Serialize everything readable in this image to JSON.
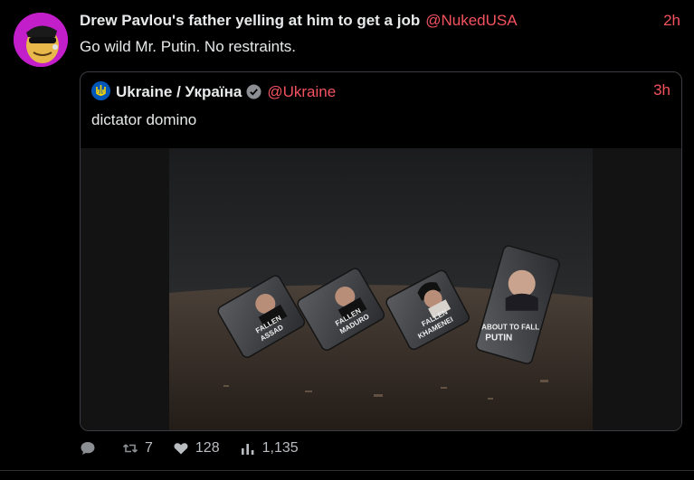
{
  "post": {
    "author": "Drew Pavlou's father yelling at him to get a job",
    "handle": "@NukedUSA",
    "time": "2h",
    "text": "Go wild Mr. Putin. No restraints.",
    "avatar_icon": "cartoon-face-avatar"
  },
  "quote": {
    "author": "Ukraine / Україна",
    "handle": "@Ukraine",
    "time": "3h",
    "text": "dictator domino",
    "verified_icon": "verified-badge-icon",
    "media": {
      "tiles": [
        {
          "line1": "FALLEN",
          "line2": "ASSAD"
        },
        {
          "line1": "FALLEN",
          "line2": "MADURO"
        },
        {
          "line1": "FALLEN",
          "line2": "KHAMENEI"
        },
        {
          "line1": "ABOUT TO FALL",
          "line2": "PUTIN"
        }
      ]
    }
  },
  "actions": {
    "reply_icon": "comment-icon",
    "retweet_count": "7",
    "like_count": "128",
    "views_count": "1,135"
  },
  "colors": {
    "accent": "#f4525f",
    "background": "#000000",
    "text": "#e7e9ea",
    "muted": "#8b8e93"
  }
}
